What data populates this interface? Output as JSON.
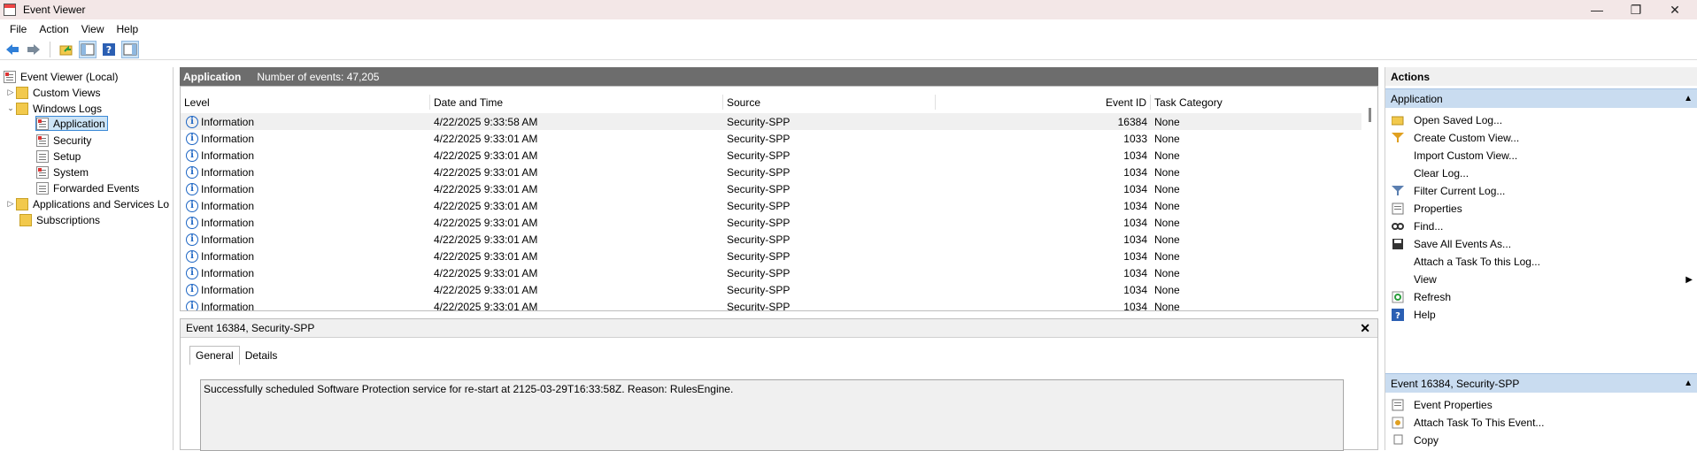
{
  "window": {
    "title": "Event Viewer",
    "minimize": "—",
    "restore": "❐",
    "close": "✕"
  },
  "menu": [
    "File",
    "Action",
    "View",
    "Help"
  ],
  "toolbar": {
    "buttons": [
      "back-icon",
      "forward-icon",
      "open-log-icon",
      "show-hide-tree-icon",
      "help-icon",
      "show-hide-action-pane-icon"
    ]
  },
  "tree": {
    "root": "Event Viewer (Local)",
    "custom_views": "Custom Views",
    "windows_logs": "Windows Logs",
    "logs": [
      "Application",
      "Security",
      "Setup",
      "System",
      "Forwarded Events"
    ],
    "apps_services": "Applications and Services Lo",
    "subscriptions": "Subscriptions"
  },
  "center": {
    "log_name": "Application",
    "count_label": "Number of events: 47,205"
  },
  "table": {
    "columns": [
      "Level",
      "Date and Time",
      "Source",
      "Event ID",
      "Task Category"
    ],
    "rows": [
      {
        "level": "Information",
        "date": "4/22/2025 9:33:58 AM",
        "source": "Security-SPP",
        "id": "16384",
        "cat": "None"
      },
      {
        "level": "Information",
        "date": "4/22/2025 9:33:01 AM",
        "source": "Security-SPP",
        "id": "1033",
        "cat": "None"
      },
      {
        "level": "Information",
        "date": "4/22/2025 9:33:01 AM",
        "source": "Security-SPP",
        "id": "1034",
        "cat": "None"
      },
      {
        "level": "Information",
        "date": "4/22/2025 9:33:01 AM",
        "source": "Security-SPP",
        "id": "1034",
        "cat": "None"
      },
      {
        "level": "Information",
        "date": "4/22/2025 9:33:01 AM",
        "source": "Security-SPP",
        "id": "1034",
        "cat": "None"
      },
      {
        "level": "Information",
        "date": "4/22/2025 9:33:01 AM",
        "source": "Security-SPP",
        "id": "1034",
        "cat": "None"
      },
      {
        "level": "Information",
        "date": "4/22/2025 9:33:01 AM",
        "source": "Security-SPP",
        "id": "1034",
        "cat": "None"
      },
      {
        "level": "Information",
        "date": "4/22/2025 9:33:01 AM",
        "source": "Security-SPP",
        "id": "1034",
        "cat": "None"
      },
      {
        "level": "Information",
        "date": "4/22/2025 9:33:01 AM",
        "source": "Security-SPP",
        "id": "1034",
        "cat": "None"
      },
      {
        "level": "Information",
        "date": "4/22/2025 9:33:01 AM",
        "source": "Security-SPP",
        "id": "1034",
        "cat": "None"
      },
      {
        "level": "Information",
        "date": "4/22/2025 9:33:01 AM",
        "source": "Security-SPP",
        "id": "1034",
        "cat": "None"
      },
      {
        "level": "Information",
        "date": "4/22/2025 9:33:01 AM",
        "source": "Security-SPP",
        "id": "1034",
        "cat": "None"
      }
    ]
  },
  "detail": {
    "title": "Event 16384, Security-SPP",
    "close": "✕",
    "tabs": [
      "General",
      "Details"
    ],
    "message": "Successfully scheduled Software Protection service for re-start at 2125-03-29T16:33:58Z. Reason: RulesEngine."
  },
  "actions": {
    "title": "Actions",
    "section1": "Application",
    "items1": [
      {
        "label": "Open Saved Log...",
        "icon": "open-log-icon"
      },
      {
        "label": "Create Custom View...",
        "icon": "create-view-icon"
      },
      {
        "label": "Import Custom View...",
        "icon": ""
      },
      {
        "label": "Clear Log...",
        "icon": ""
      },
      {
        "label": "Filter Current Log...",
        "icon": "filter-icon"
      },
      {
        "label": "Properties",
        "icon": "properties-icon"
      },
      {
        "label": "Find...",
        "icon": "find-icon"
      },
      {
        "label": "Save All Events As...",
        "icon": "save-icon"
      },
      {
        "label": "Attach a Task To this Log...",
        "icon": ""
      },
      {
        "label": "View",
        "icon": ""
      },
      {
        "label": "Refresh",
        "icon": "refresh-icon"
      },
      {
        "label": "Help",
        "icon": "help-icon"
      }
    ],
    "section2": "Event 16384, Security-SPP",
    "items2": [
      {
        "label": "Event Properties",
        "icon": "properties-icon"
      },
      {
        "label": "Attach Task To This Event...",
        "icon": "task-icon"
      },
      {
        "label": "Copy",
        "icon": "copy-icon"
      }
    ]
  }
}
